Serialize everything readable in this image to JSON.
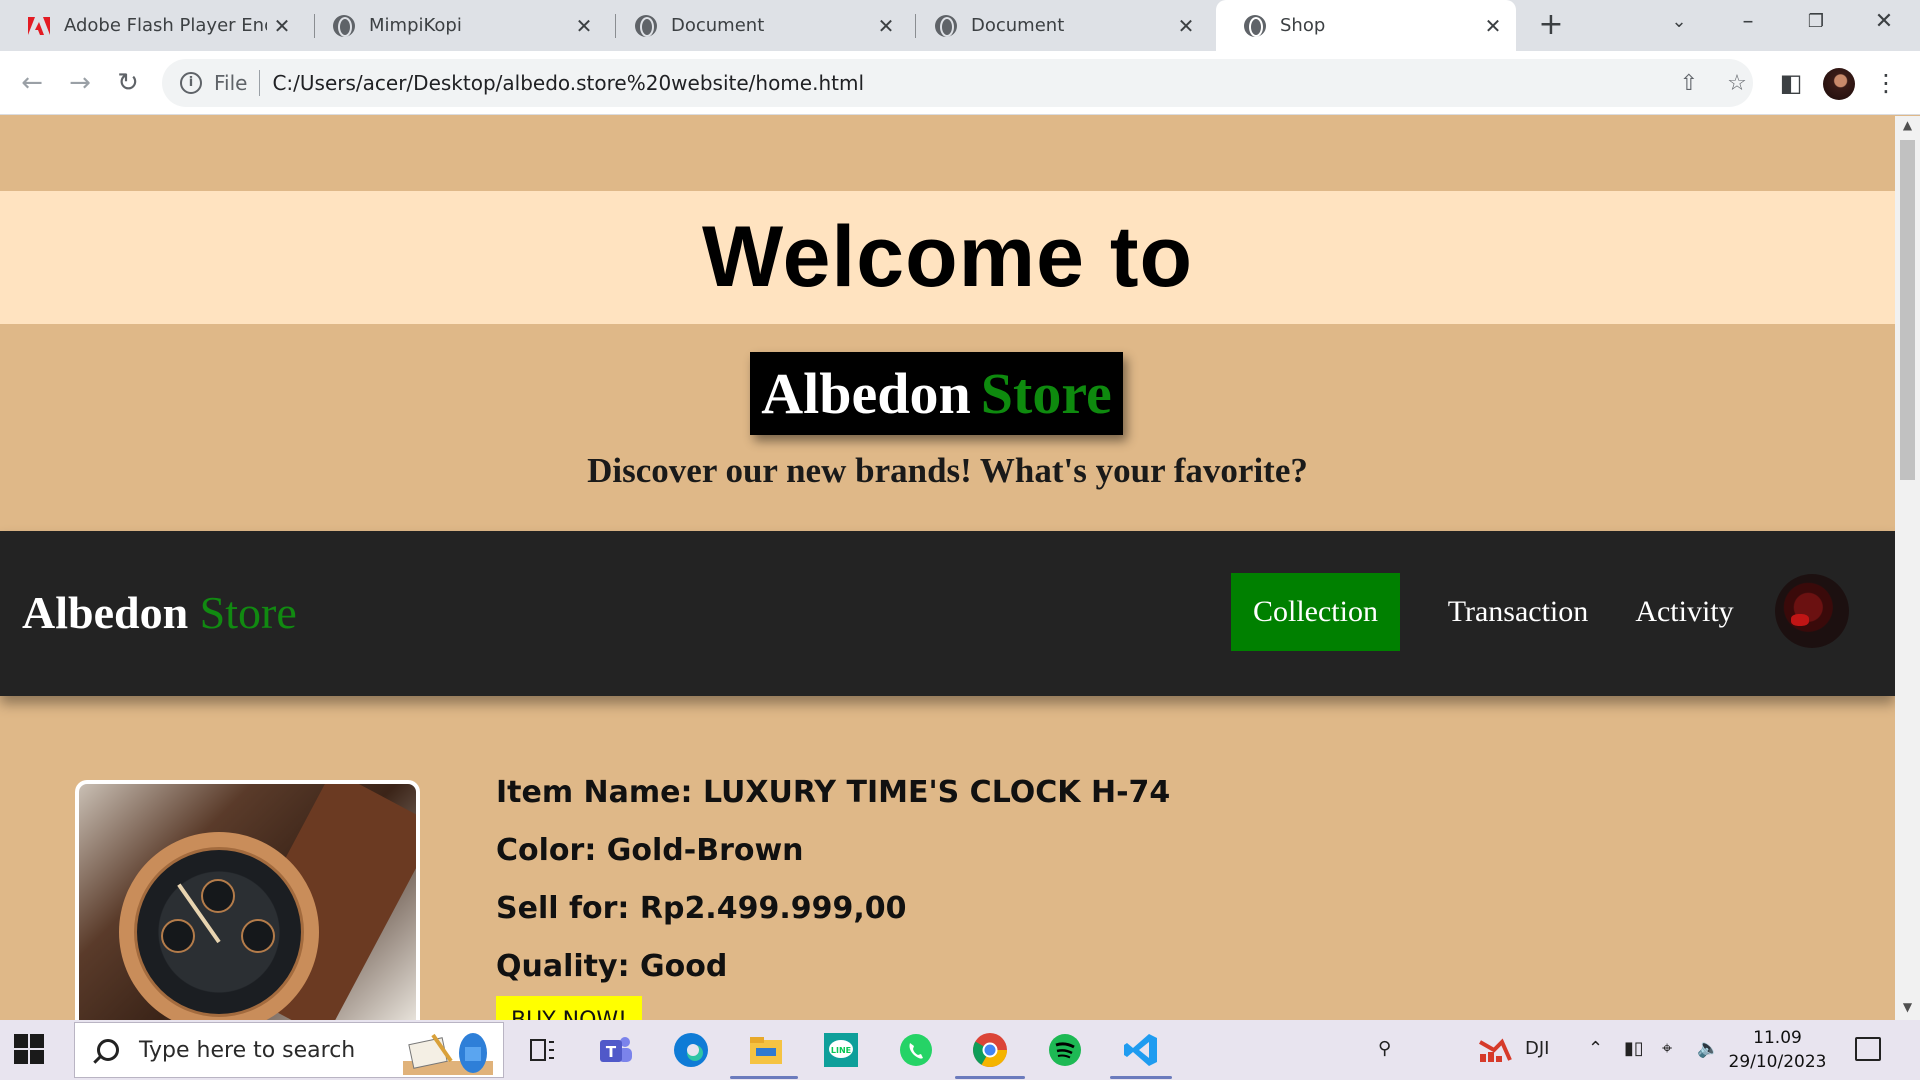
{
  "browser": {
    "tabs": [
      {
        "title": "Adobe Flash Player End of Life",
        "icon": "adobe-icon"
      },
      {
        "title": "MimpiKopi",
        "icon": "globe-icon"
      },
      {
        "title": "Document",
        "icon": "globe-icon"
      },
      {
        "title": "Document",
        "icon": "globe-icon"
      },
      {
        "title": "Shop",
        "icon": "globe-icon",
        "active": true
      }
    ],
    "close_glyph": "✕",
    "new_tab_glyph": "+",
    "omnibox": {
      "scheme_label": "File",
      "url": "C:/Users/acer/Desktop/albedo.store%20website/home.html"
    }
  },
  "page": {
    "welcome_heading": "Welcome to",
    "store_badge": {
      "word1": "Albedon",
      "word2": "Store"
    },
    "tagline": "Discover our new brands! What's your favorite?",
    "nav": {
      "logo": {
        "word1": "Albedon",
        "word2": "Store"
      },
      "links": [
        {
          "label": "Collection",
          "active": true
        },
        {
          "label": "Transaction",
          "active": false
        },
        {
          "label": "Activity",
          "active": false
        }
      ]
    },
    "product": {
      "name_line": "Item Name: LUXURY TIME'S CLOCK H-74",
      "color_line": "Color: Gold-Brown",
      "price_line": "Sell for: Rp2.499.999,00",
      "quality_line": "Quality: Good",
      "buy_label": "BUY NOW!"
    }
  },
  "taskbar": {
    "search_placeholder": "Type here to search",
    "tray_app_label": "DJI",
    "time": "11.09",
    "date": "29/10/2023"
  },
  "colors": {
    "page_bg": "#dfb888",
    "welcome_band": "#ffe3c0",
    "nav_bg": "#232323",
    "accent_green": "#008000",
    "buy_button": "#ffff00"
  }
}
